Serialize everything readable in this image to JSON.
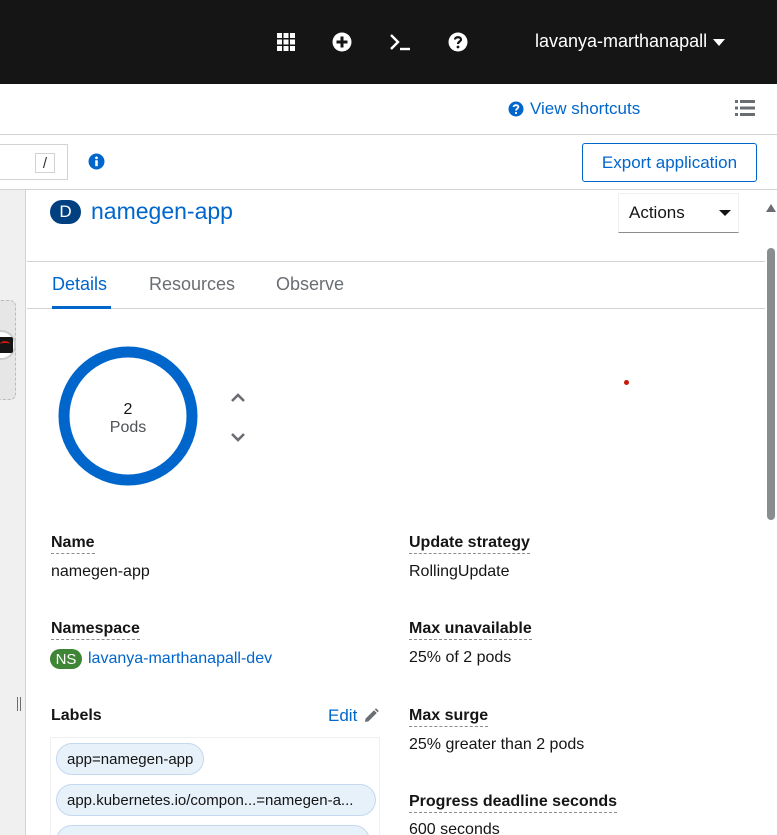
{
  "masthead": {
    "icons": [
      "grid-icon",
      "plus-circle-icon",
      "terminal-icon",
      "help-icon"
    ],
    "user_name": "lavanya-marthanapall"
  },
  "toolbar": {
    "shortcuts_label": "View shortcuts",
    "filter_slash": "/",
    "export_label": "Export application"
  },
  "panel": {
    "kind_badge": "D",
    "title": "namegen-app",
    "actions_label": "Actions",
    "tabs": [
      {
        "label": "Details",
        "active": true
      },
      {
        "label": "Resources",
        "active": false
      },
      {
        "label": "Observe",
        "active": false
      }
    ],
    "pods": {
      "count": "2",
      "label": "Pods"
    },
    "details": {
      "name_label": "Name",
      "name_value": "namegen-app",
      "namespace_label": "Namespace",
      "namespace_badge": "NS",
      "namespace_value": "lavanya-marthanapall-dev",
      "labels_label": "Labels",
      "edit_label": "Edit",
      "labels": [
        "app=namegen-app",
        "app.kubernetes.io/compon...=namegen-a..."
      ],
      "update_strategy_label": "Update strategy",
      "update_strategy_value": "RollingUpdate",
      "max_unavailable_label": "Max unavailable",
      "max_unavailable_value": "25% of 2 pods",
      "max_surge_label": "Max surge",
      "max_surge_value": "25% greater than 2 pods",
      "progress_deadline_label": "Progress deadline seconds",
      "progress_deadline_value": "600 seconds"
    }
  },
  "colors": {
    "masthead_bg": "#151515",
    "link": "#0066cc",
    "donut": "#0066cc",
    "ns_badge": "#3e8635",
    "d_badge": "#004080"
  }
}
